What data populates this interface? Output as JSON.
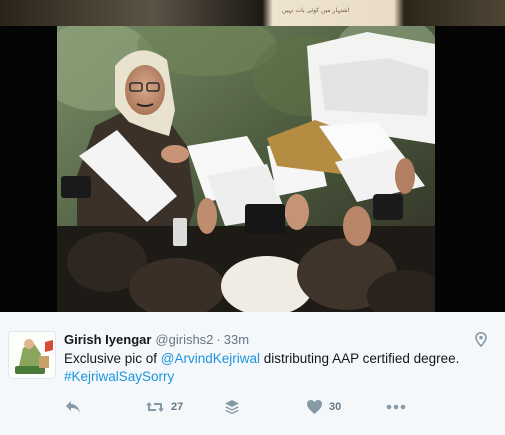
{
  "media": {
    "top_strip_caption": "اشتہار میں کوئی بات نہیں",
    "photo_alt": "Man in a white scarf and glasses distributing sheets of paper to a crowd"
  },
  "tweet": {
    "display_name": "Girish Iyengar",
    "username": "@girishs2",
    "separator": "·",
    "timestamp": "33m",
    "text_before_mention": "Exclusive pic of ",
    "mention": "@ArvindKejriwal",
    "text_after_mention": " distributing AAP certified degree.",
    "hashtag": "#KejriwalSaySorry"
  },
  "actions": {
    "retweet_count": "27",
    "like_count": "30"
  },
  "colors": {
    "link": "#1b95e0",
    "text": "#14171a",
    "muted": "#657786",
    "action_icon": "#8899a6",
    "background": "#f5f8fa"
  },
  "icons": [
    "location-pin-icon",
    "reply-icon",
    "retweet-icon",
    "stack-icon",
    "heart-icon",
    "more-icon"
  ]
}
